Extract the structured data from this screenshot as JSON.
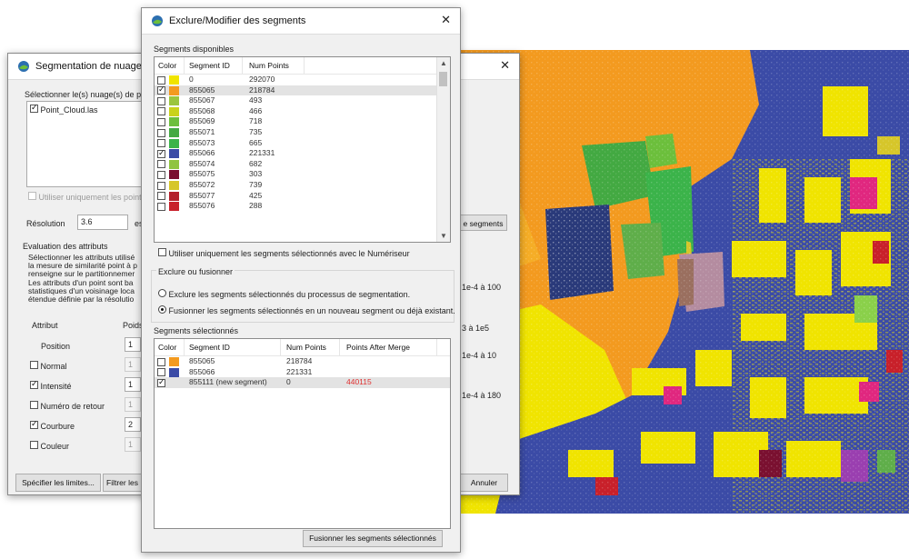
{
  "back_dialog": {
    "title": "Segmentation de nuage de",
    "select_clouds_label": "Sélectionner le(s) nuage(s) de p",
    "cloud_item": "Point_Cloud.las",
    "use_only_points_label": "Utiliser uniquement les points",
    "resolution_label": "Résolution",
    "resolution_value": "3.6",
    "resolution_unit": "es",
    "segments_button": "e segments",
    "eval_group_title": "Evaluation des attributs",
    "eval_desc": [
      "Sélectionner les attributs utilisé",
      "la mesure de similarité point à p",
      "renseigne sur le partitionnemer",
      "Les attributs d'un point sont ba",
      "statistiques d'un voisinage loca",
      "étendue définie par la résolutio"
    ],
    "col_attribut": "Attribut",
    "col_poids": "Poids",
    "attributes": [
      {
        "name": "Position",
        "weight": "1"
      },
      {
        "name": "Normal",
        "weight": "1"
      },
      {
        "name": "Intensité",
        "weight": "1"
      },
      {
        "name": "Numéro de retour",
        "weight": "1"
      },
      {
        "name": "Courbure",
        "weight": "2"
      },
      {
        "name": "Couleur",
        "weight": "1"
      }
    ],
    "ranges": [
      "1e-4 à 100",
      "3 à 1e5",
      "1e-4 à 10",
      "1e-4 à 180"
    ],
    "specify_limits_button": "Spécifier les limites...",
    "filter_button": "Filtrer les",
    "cancel_button": "Annuler",
    "close_glyph": "✕"
  },
  "front_dialog": {
    "title": "Exclure/Modifier des segments",
    "close_glyph": "✕",
    "available_title": "Segments disponibles",
    "available_columns": [
      "Color",
      "Segment ID",
      "Num Points"
    ],
    "available_rows": [
      {
        "id": "0",
        "points": "292070",
        "color": "#f0e400",
        "checked": false,
        "selected": false
      },
      {
        "id": "855065",
        "points": "218784",
        "color": "#f39a1f",
        "checked": true,
        "selected": true
      },
      {
        "id": "855067",
        "points": "493",
        "color": "#9bc53d",
        "checked": false,
        "selected": false
      },
      {
        "id": "855068",
        "points": "466",
        "color": "#c9d21b",
        "checked": false,
        "selected": false
      },
      {
        "id": "855069",
        "points": "718",
        "color": "#6cbf3c",
        "checked": false,
        "selected": false
      },
      {
        "id": "855071",
        "points": "735",
        "color": "#43a942",
        "checked": false,
        "selected": false
      },
      {
        "id": "855073",
        "points": "665",
        "color": "#3bb34a",
        "checked": false,
        "selected": false
      },
      {
        "id": "855066",
        "points": "221331",
        "color": "#3b4ba6",
        "checked": true,
        "selected": false
      },
      {
        "id": "855074",
        "points": "682",
        "color": "#8fc43f",
        "checked": false,
        "selected": false
      },
      {
        "id": "855075",
        "points": "303",
        "color": "#7a1030",
        "checked": false,
        "selected": false
      },
      {
        "id": "855072",
        "points": "739",
        "color": "#d6c62a",
        "checked": false,
        "selected": false
      },
      {
        "id": "855077",
        "points": "425",
        "color": "#b3202c",
        "checked": false,
        "selected": false
      },
      {
        "id": "855076",
        "points": "288",
        "color": "#c8202a",
        "checked": false,
        "selected": false
      }
    ],
    "use_only_selected_label": "Utiliser uniquement les segments sélectionnés avec le Numériseur",
    "exclude_group_title": "Exclure ou fusionner",
    "option_exclude": "Exclure les segments sélectionnés du processus de segmentation.",
    "option_merge": "Fusionner les segments sélectionnés en un nouveau segment ou déjà existant.",
    "selected_title": "Segments sélectionnés",
    "selected_columns": [
      "Color",
      "Segment ID",
      "Num Points",
      "Points After Merge"
    ],
    "selected_rows": [
      {
        "id": "855065",
        "points": "218784",
        "after": "",
        "color": "#f39a1f",
        "checked": false,
        "selected": false
      },
      {
        "id": "855066",
        "points": "221331",
        "after": "",
        "color": "#3b4ba6",
        "checked": false,
        "selected": false
      },
      {
        "id": "855111 (new segment)",
        "points": "0",
        "after": "440115",
        "color": "",
        "checked": true,
        "selected": true
      }
    ],
    "merge_button": "Fusionner les segments sélectionnés"
  },
  "colors": {
    "after_merge_text": "#e03030",
    "map_blue": "#3b4ba6",
    "map_orange": "#f39a1f",
    "map_yellow": "#f0e400"
  },
  "icons": {
    "app_icon": "app-logo-icon",
    "close": "close-icon",
    "checkbox": "checkbox-icon",
    "radio": "radio-icon",
    "scroll_up": "scroll-up-arrow-icon",
    "scroll_down": "scroll-down-arrow-icon"
  }
}
